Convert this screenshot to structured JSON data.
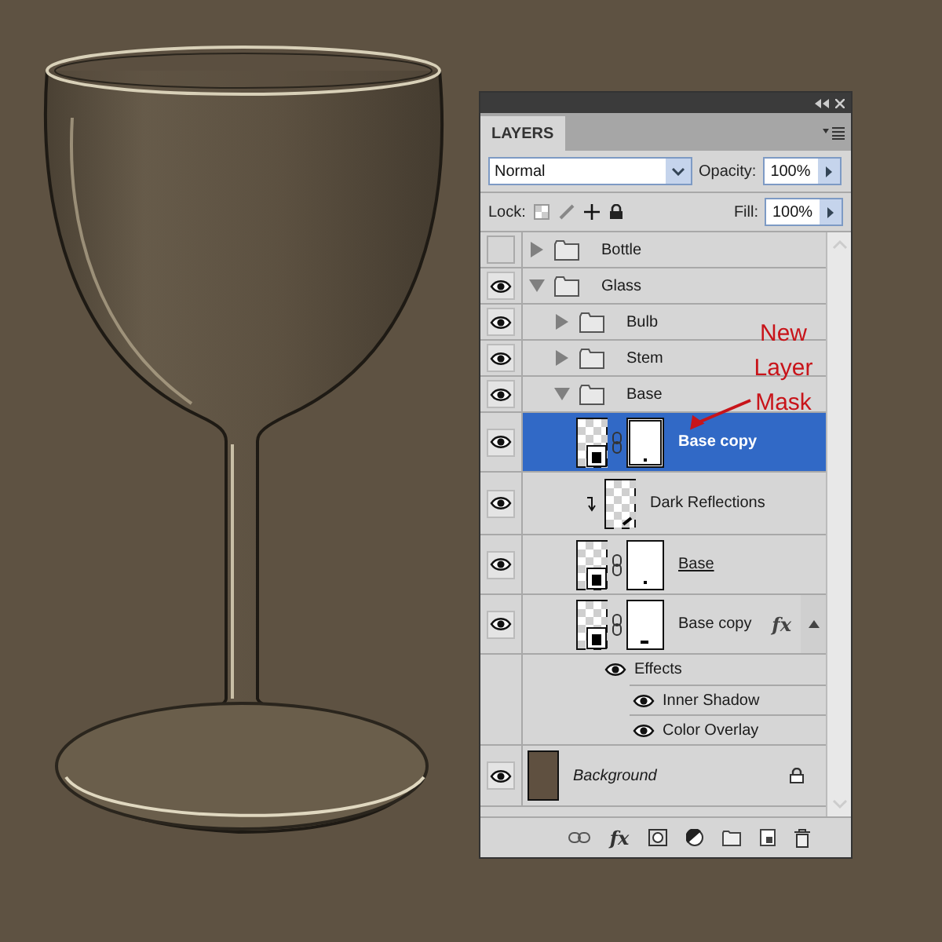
{
  "annotation": {
    "text": "New Layer Mask"
  },
  "panel": {
    "title": "LAYERS",
    "blend_mode": "Normal",
    "opacity_label": "Opacity:",
    "opacity_value": "100%",
    "lock_label": "Lock:",
    "fill_label": "Fill:",
    "fill_value": "100%",
    "footer_fx": "fx"
  },
  "layers": [
    {
      "kind": "group",
      "name": "Bottle",
      "visible": false,
      "expanded": false,
      "selected": false
    },
    {
      "kind": "group",
      "name": "Glass",
      "visible": true,
      "expanded": true,
      "selected": false,
      "children": [
        {
          "kind": "group",
          "name": "Bulb",
          "visible": true,
          "expanded": false,
          "selected": false
        },
        {
          "kind": "group",
          "name": "Stem",
          "visible": true,
          "expanded": false,
          "selected": false
        },
        {
          "kind": "group",
          "name": "Base",
          "visible": true,
          "expanded": true,
          "selected": false,
          "children": [
            {
              "kind": "layer",
              "name": "Base copy",
              "visible": true,
              "selected": true,
              "mask": true,
              "clipped": false,
              "underlined": false
            },
            {
              "kind": "layer",
              "name": "Dark Reflections",
              "visible": true,
              "selected": false,
              "mask": false,
              "clipped": true,
              "underlined": false
            },
            {
              "kind": "layer",
              "name": "Base",
              "visible": true,
              "selected": false,
              "mask": true,
              "clipped": false,
              "underlined": true
            },
            {
              "kind": "layer",
              "name": "Base copy",
              "visible": true,
              "selected": false,
              "mask": true,
              "clipped": false,
              "underlined": false,
              "fx": "fx",
              "expanded": true,
              "children": [
                {
                  "kind": "effects",
                  "name": "Effects",
                  "visible": true,
                  "children": [
                    {
                      "kind": "effect",
                      "name": "Inner Shadow",
                      "visible": true
                    },
                    {
                      "kind": "effect",
                      "name": "Color Overlay",
                      "visible": true
                    }
                  ]
                }
              ]
            }
          ]
        }
      ]
    },
    {
      "kind": "background",
      "name": "Background",
      "visible": true,
      "selected": false,
      "locked": true
    }
  ]
}
